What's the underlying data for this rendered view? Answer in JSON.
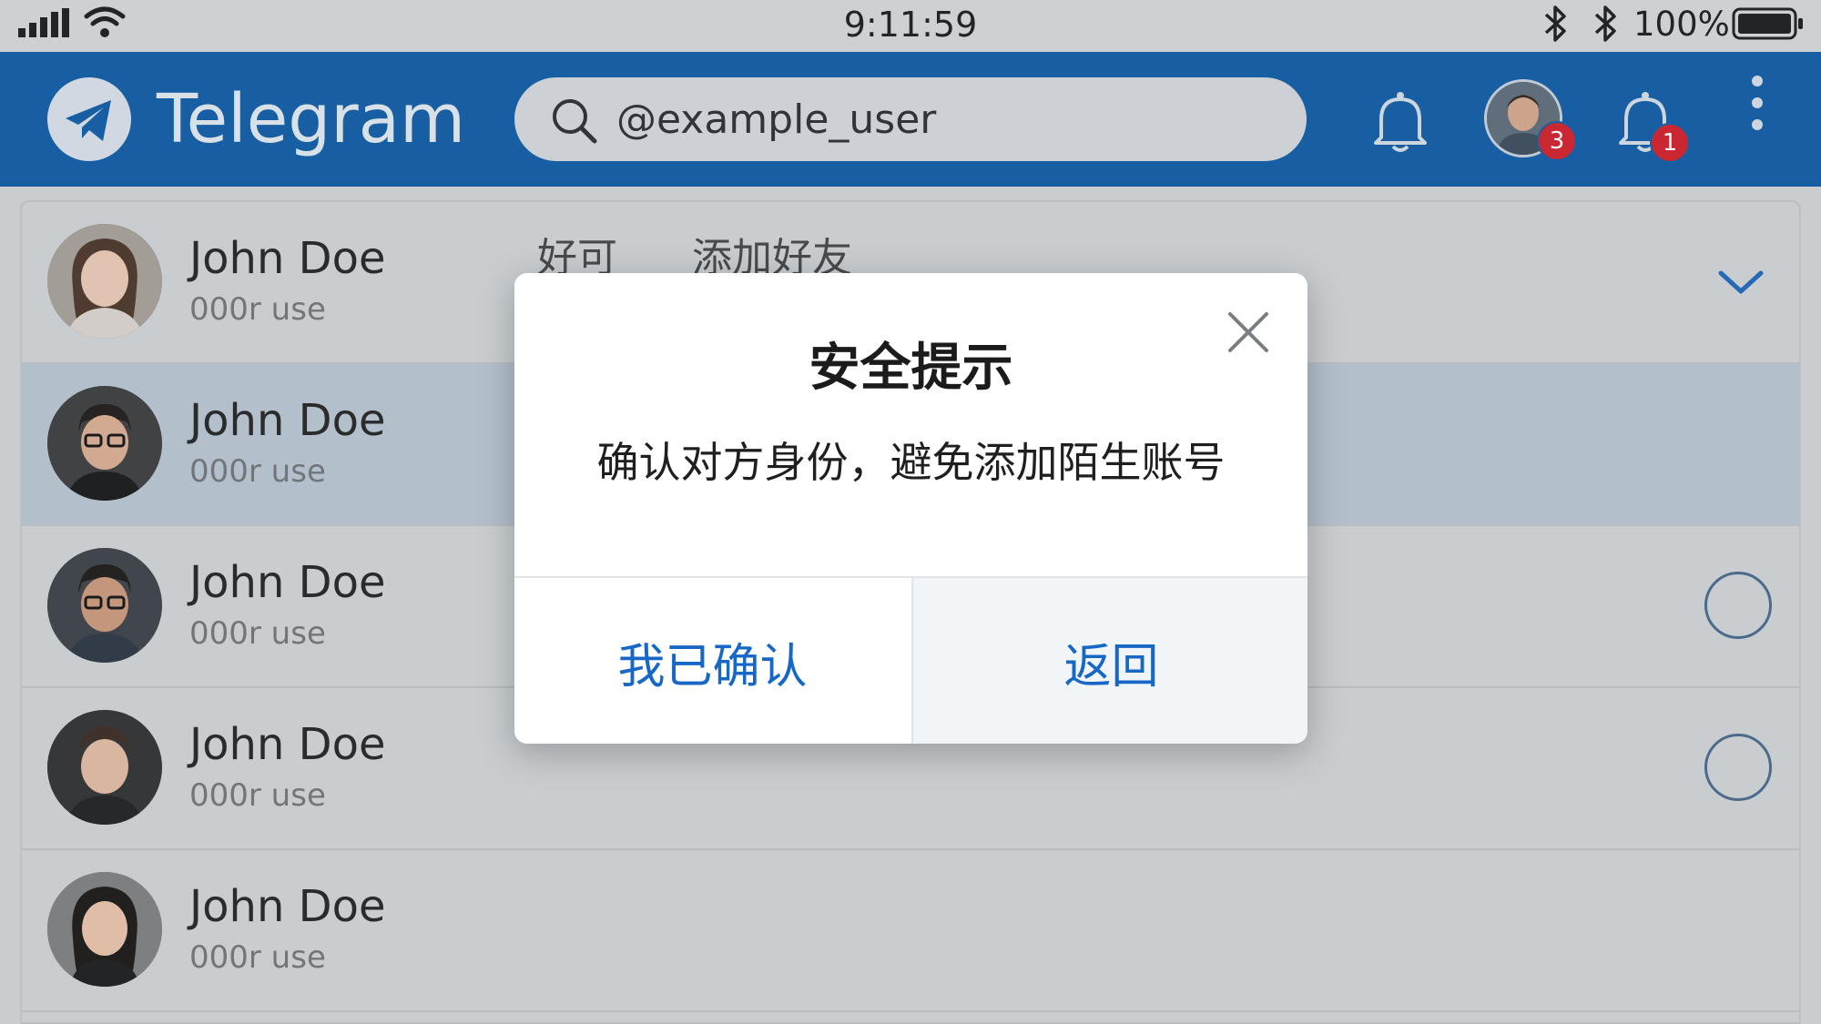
{
  "status_bar": {
    "time": "9:11:59",
    "battery_percent": "100%",
    "icons": [
      "signal-icon",
      "wifi-icon",
      "bluetooth-icon",
      "bluetooth-icon",
      "battery-icon"
    ]
  },
  "app_bar": {
    "title": "Telegram",
    "search": {
      "value": "@example_user",
      "icon": "search-icon"
    },
    "avatar_badge": "3",
    "bell_badge": "1",
    "icons": [
      "telegram-logo-icon",
      "bell-icon",
      "avatar",
      "bell-icon",
      "more-vertical-icon"
    ]
  },
  "contacts": [
    {
      "name": "John Doe",
      "subtitle": "000r use",
      "control": "chevron-down"
    },
    {
      "name": "John Doe",
      "subtitle": "000r use",
      "control": "none",
      "selected": true
    },
    {
      "name": "John Doe",
      "subtitle": "000r use",
      "control": "radio"
    },
    {
      "name": "John Doe",
      "subtitle": "000r use",
      "control": "radio"
    },
    {
      "name": "John Doe",
      "subtitle": "000r use",
      "control": "none"
    }
  ],
  "row_actions": [
    "好可",
    "添加好友"
  ],
  "dialog": {
    "title": "安全提示",
    "message": "确认对方身份，避免添加陌生账号",
    "confirm_label": "我已确认",
    "back_label": "返回"
  },
  "colors": {
    "app_bar": "#0f5aa3",
    "accent": "#1667c6",
    "badge": "#cf1f2a",
    "selected_row": "#b7c3cf"
  }
}
